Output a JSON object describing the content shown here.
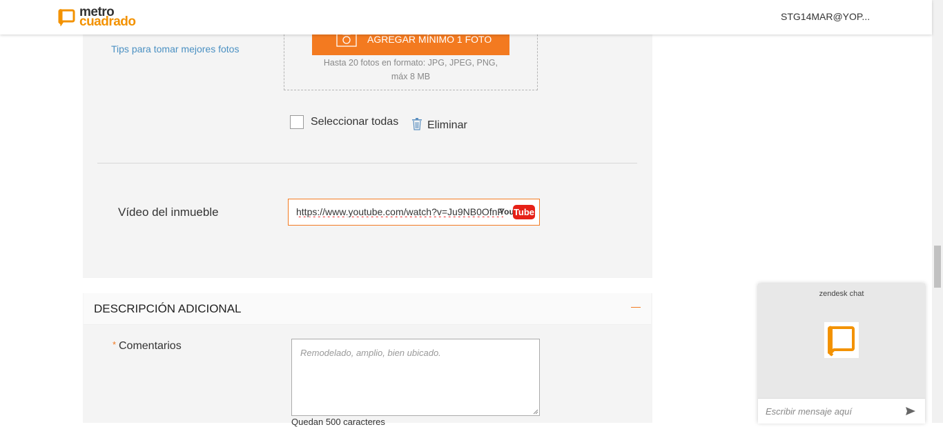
{
  "header": {
    "logo_top": "metro",
    "logo_bottom": "cuadrado",
    "user": "STG14MAR@YOP..."
  },
  "photos": {
    "tips_link": "Tips para tomar mejores fotos",
    "upload_label": "AGREGAR MÍNIMO 1 FOTO",
    "hint": "Hasta 20 fotos en formato: JPG, JPEG, PNG, máx 8 MB",
    "select_all": "Seleccionar todas",
    "delete": "Eliminar"
  },
  "video": {
    "label": "Vídeo del inmueble",
    "value": "https://www.youtube.com/watch?v=Ju9NB0OfnF",
    "brand_you": "You",
    "brand_tube": "Tube"
  },
  "additional": {
    "title": "DESCRIPCIÓN ADICIONAL",
    "required_mark": "*",
    "comments_label": "Comentarios",
    "comments_placeholder": "Remodelado, amplio, bien ubicado.",
    "remaining": "Quedan 500 caracteres"
  },
  "chat": {
    "title": "zendesk chat",
    "placeholder": "Escribir mensaje aquí"
  },
  "colors": {
    "accent": "#f37a20",
    "brand": "#f39200",
    "link": "#4a90c2"
  }
}
